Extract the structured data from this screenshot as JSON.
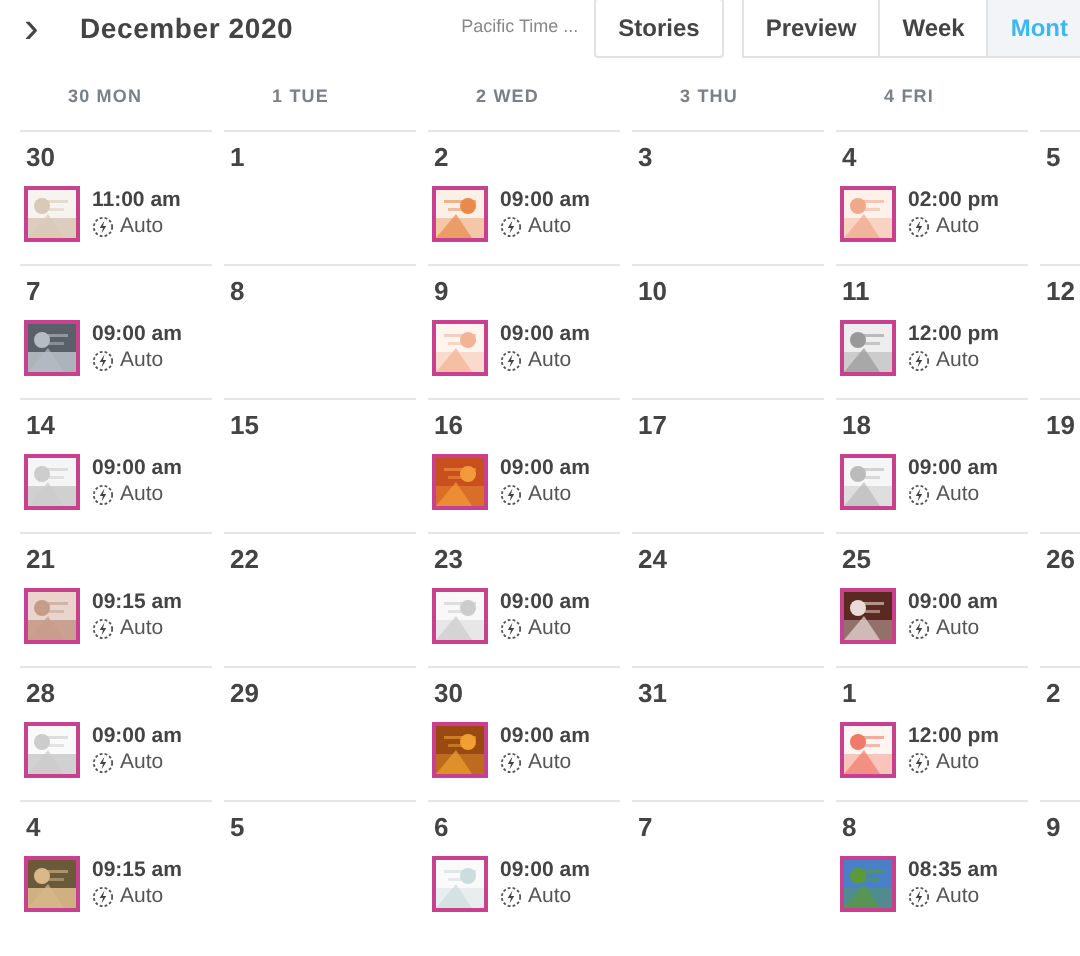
{
  "header": {
    "nav_icon": "›",
    "title": "December 2020",
    "timezone": "Pacific Time ...",
    "stories_button": "Stories",
    "view_tabs": [
      {
        "label": "Preview",
        "selected": false
      },
      {
        "label": "Week",
        "selected": false
      },
      {
        "label": "Mont",
        "selected": true
      }
    ]
  },
  "weekdays": [
    "30 MON",
    "1 TUE",
    "2 WED",
    "3 THU",
    "4 FRI"
  ],
  "weeks": [
    [
      {
        "day": "30",
        "post": {
          "time": "11:00 am",
          "mode": "Auto",
          "kind": "picture"
        }
      },
      {
        "day": "1"
      },
      {
        "day": "2",
        "post": {
          "time": "09:00 am",
          "mode": "Auto",
          "kind": "picture"
        }
      },
      {
        "day": "3"
      },
      {
        "day": "4",
        "post": {
          "time": "02:00 pm",
          "mode": "Auto",
          "kind": "picture"
        }
      },
      {
        "day": "5"
      }
    ],
    [
      {
        "day": "7",
        "post": {
          "time": "09:00 am",
          "mode": "Auto",
          "kind": "picture"
        }
      },
      {
        "day": "8"
      },
      {
        "day": "9",
        "post": {
          "time": "09:00 am",
          "mode": "Auto",
          "kind": "picture"
        }
      },
      {
        "day": "10"
      },
      {
        "day": "11",
        "post": {
          "time": "12:00 pm",
          "mode": "Auto",
          "kind": "picture"
        }
      },
      {
        "day": "12"
      }
    ],
    [
      {
        "day": "14",
        "post": {
          "time": "09:00 am",
          "mode": "Auto",
          "kind": "picture"
        }
      },
      {
        "day": "15"
      },
      {
        "day": "16",
        "post": {
          "time": "09:00 am",
          "mode": "Auto",
          "kind": "picture"
        }
      },
      {
        "day": "17"
      },
      {
        "day": "18",
        "post": {
          "time": "09:00 am",
          "mode": "Auto",
          "kind": "picture"
        }
      },
      {
        "day": "19"
      }
    ],
    [
      {
        "day": "21",
        "post": {
          "time": "09:15 am",
          "mode": "Auto",
          "kind": "picture"
        }
      },
      {
        "day": "22"
      },
      {
        "day": "23",
        "post": {
          "time": "09:00 am",
          "mode": "Auto",
          "kind": "picture"
        }
      },
      {
        "day": "24"
      },
      {
        "day": "25",
        "post": {
          "time": "09:00 am",
          "mode": "Auto",
          "kind": "picture"
        }
      },
      {
        "day": "26"
      }
    ],
    [
      {
        "day": "28",
        "post": {
          "time": "09:00 am",
          "mode": "Auto",
          "kind": "picture"
        }
      },
      {
        "day": "29"
      },
      {
        "day": "30",
        "post": {
          "time": "09:00 am",
          "mode": "Auto",
          "kind": "picture"
        }
      },
      {
        "day": "31"
      },
      {
        "day": "1",
        "post": {
          "time": "12:00 pm",
          "mode": "Auto",
          "kind": "picture"
        }
      },
      {
        "day": "2"
      }
    ],
    [
      {
        "day": "4",
        "post": {
          "time": "09:15 am",
          "mode": "Auto",
          "kind": "picture"
        }
      },
      {
        "day": "5"
      },
      {
        "day": "6",
        "post": {
          "time": "09:00 am",
          "mode": "Auto",
          "kind": "picture"
        }
      },
      {
        "day": "7"
      },
      {
        "day": "8",
        "post": {
          "time": "08:35 am",
          "mode": "Auto",
          "kind": "picture"
        }
      },
      {
        "day": "9"
      }
    ]
  ]
}
